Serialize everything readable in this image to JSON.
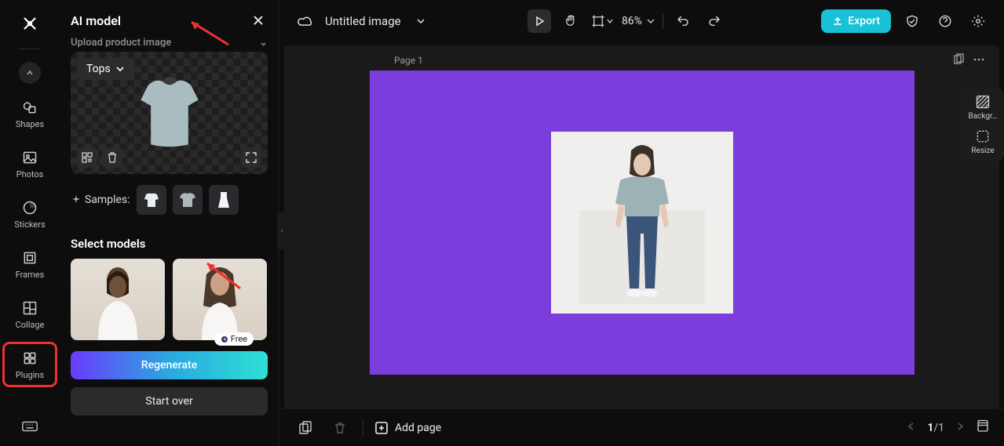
{
  "rail": {
    "items": [
      {
        "label": "Shapes",
        "icon": "shapes"
      },
      {
        "label": "Photos",
        "icon": "photos"
      },
      {
        "label": "Stickers",
        "icon": "stickers"
      },
      {
        "label": "Frames",
        "icon": "frames"
      },
      {
        "label": "Collage",
        "icon": "collage"
      },
      {
        "label": "Plugins",
        "icon": "plugins"
      }
    ]
  },
  "panel": {
    "title": "AI model",
    "upload_label": "Upload product image",
    "category": "Tops",
    "samples_label": "Samples:",
    "select_models_label": "Select models",
    "free_badge": "Free",
    "regenerate_label": "Regenerate",
    "startover_label": "Start over"
  },
  "topbar": {
    "doc_title": "Untitled image",
    "zoom": "86%",
    "export_label": "Export"
  },
  "canvas": {
    "page_label": "Page 1",
    "board_color": "#7b3ddb"
  },
  "rtools": {
    "items": [
      {
        "label": "Backgr…",
        "icon": "background"
      },
      {
        "label": "Resize",
        "icon": "resize"
      }
    ]
  },
  "bottom": {
    "add_page_label": "Add page",
    "page_current": "1",
    "page_total": "1"
  }
}
